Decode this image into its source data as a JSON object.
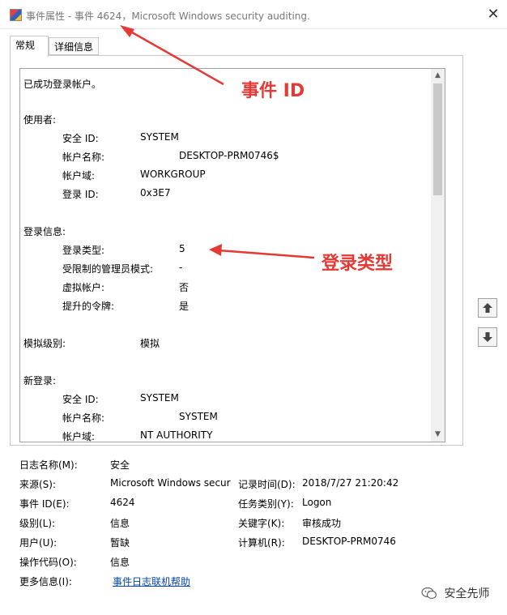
{
  "window": {
    "title": "事件属性 - 事件 4624，Microsoft Windows security auditing.",
    "close_glyph": "✕"
  },
  "tabs": [
    {
      "label": "常规",
      "selected": true
    },
    {
      "label": "详细信息",
      "selected": false
    }
  ],
  "description": {
    "summary": "已成功登录帐户。",
    "subject_header": "使用者:",
    "subject": [
      {
        "label": "安全 ID:",
        "value": "SYSTEM"
      },
      {
        "label": "帐户名称:",
        "value": "DESKTOP-PRM0746$"
      },
      {
        "label": "帐户域:",
        "value": "WORKGROUP"
      },
      {
        "label": "登录 ID:",
        "value": "0x3E7"
      }
    ],
    "logon_header": "登录信息:",
    "logon": [
      {
        "label": "登录类型:",
        "value": "5"
      },
      {
        "label": "受限制的管理员模式:",
        "value": "-"
      },
      {
        "label": "虚拟帐户:",
        "value": "否"
      },
      {
        "label": "提升的令牌:",
        "value": "是"
      }
    ],
    "impersonation_label": "模拟级别:",
    "impersonation_value": "模拟",
    "new_logon_header": "新登录:",
    "new_logon": [
      {
        "label": "安全 ID:",
        "value": "SYSTEM"
      },
      {
        "label": "帐户名称:",
        "value": "SYSTEM"
      },
      {
        "label": "帐户域:",
        "value": "NT AUTHORITY"
      }
    ]
  },
  "properties": {
    "log_name_label": "日志名称(M):",
    "log_name_value": "安全",
    "source_label": "来源(S):",
    "source_value": "Microsoft Windows secur",
    "logged_label": "记录时间(D):",
    "logged_value": "2018/7/27 21:20:42",
    "event_id_label": "事件 ID(E):",
    "event_id_value": "4624",
    "task_label": "任务类别(Y):",
    "task_value": "Logon",
    "level_label": "级别(L):",
    "level_value": "信息",
    "keywords_label": "关键字(K):",
    "keywords_value": "审核成功",
    "user_label": "用户(U):",
    "user_value": "暂缺",
    "computer_label": "计算机(R):",
    "computer_value": "DESKTOP-PRM0746",
    "opcode_label": "操作代码(O):",
    "opcode_value": "信息",
    "more_info_label": "更多信息(I):",
    "more_info_link": "事件日志联机帮助"
  },
  "annotations": {
    "event_id": "事件 ID",
    "logon_type": "登录类型",
    "color": "#e53935"
  },
  "watermark": {
    "text": "安全先师",
    "icon": "wechat-icon"
  },
  "icons": {
    "scroll_up": "▲",
    "scroll_down": "▼"
  }
}
